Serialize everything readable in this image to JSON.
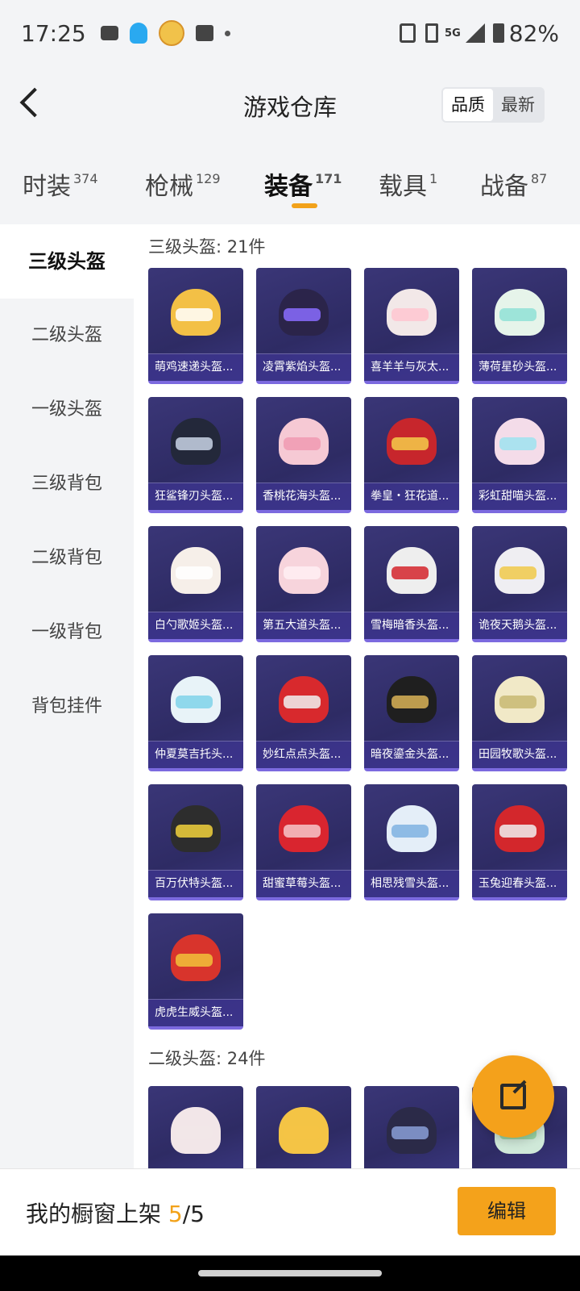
{
  "status_bar": {
    "time": "17:25",
    "network": "5G",
    "battery": "82%"
  },
  "header": {
    "title": "游戏仓库",
    "sort_options": [
      "品质",
      "最新"
    ],
    "sort_selected": "品质"
  },
  "tabs": [
    {
      "label": "时装",
      "count": "374"
    },
    {
      "label": "枪械",
      "count": "129"
    },
    {
      "label": "装备",
      "count": "171"
    },
    {
      "label": "载具",
      "count": "1"
    },
    {
      "label": "战备",
      "count": "87"
    }
  ],
  "active_tab": "装备",
  "sidebar": {
    "items": [
      "三级头盔",
      "二级头盔",
      "一级头盔",
      "三级背包",
      "二级背包",
      "一级背包",
      "背包挂件"
    ],
    "active": "三级头盔"
  },
  "sections": [
    {
      "title": "三级头盔: 21件",
      "items": [
        {
          "name": "萌鸡速递头盔...",
          "color": "#f3c046",
          "visor": "#ffffff"
        },
        {
          "name": "凌霄紫焰头盔...",
          "color": "#2b244a",
          "visor": "#8a6cff"
        },
        {
          "name": "喜羊羊与灰太...",
          "color": "#f2e8e8",
          "visor": "#ffc6d0"
        },
        {
          "name": "薄荷星砂头盔...",
          "color": "#e6f4ea",
          "visor": "#8fe0d6"
        },
        {
          "name": "狂鲨锋刃头盔...",
          "color": "#23283a",
          "visor": "#c9d4e6"
        },
        {
          "name": "香桃花海头盔...",
          "color": "#f6c9d4",
          "visor": "#f09ab2"
        },
        {
          "name": "拳皇・狂花道...",
          "color": "#c7262c",
          "visor": "#f4cc4a"
        },
        {
          "name": "彩虹甜喵头盔...",
          "color": "#f4dce9",
          "visor": "#9ee3f0"
        },
        {
          "name": "白勺歌姬头盔...",
          "color": "#f6efe9",
          "visor": "#ffffff"
        },
        {
          "name": "第五大道头盔...",
          "color": "#f7d4dc",
          "visor": "#ffeef3"
        },
        {
          "name": "雪梅暗香头盔...",
          "color": "#eeeeee",
          "visor": "#d4242c"
        },
        {
          "name": "诡夜天鹅头盔...",
          "color": "#efeef2",
          "visor": "#f0c94a"
        },
        {
          "name": "仲夏莫吉托头...",
          "color": "#e8f3f8",
          "visor": "#7fd2ea"
        },
        {
          "name": "妙红点点头盔...",
          "color": "#d8292d",
          "visor": "#f1f1f1"
        },
        {
          "name": "暗夜鎏金头盔...",
          "color": "#1f1f1f",
          "visor": "#d9b357"
        },
        {
          "name": "田园牧歌头盔...",
          "color": "#f1e9c7",
          "visor": "#c8b872"
        },
        {
          "name": "百万伏特头盔...",
          "color": "#2d2d2d",
          "visor": "#f2d23c"
        },
        {
          "name": "甜蜜草莓头盔...",
          "color": "#d9252f",
          "visor": "#f6c6c9"
        },
        {
          "name": "相思残雪头盔...",
          "color": "#e4eef8",
          "visor": "#7fb1e2"
        },
        {
          "name": "玉兔迎春头盔...",
          "color": "#d3272c",
          "visor": "#f0f0f0"
        },
        {
          "name": "虎虎生威头盔...",
          "color": "#d8342c",
          "visor": "#f2c23a"
        }
      ]
    },
    {
      "title": "二级头盔: 24件",
      "items": [
        {
          "name": "",
          "color": "#f2e6e8",
          "visor": "#f2e6e8"
        },
        {
          "name": "",
          "color": "#f4c445",
          "visor": "#f4c445"
        },
        {
          "name": "",
          "color": "#2b2a48",
          "visor": "#8a9fd8"
        },
        {
          "name": "",
          "color": "#cfe8d8",
          "visor": "#8fd09a"
        }
      ]
    }
  ],
  "bottom": {
    "label": "我的橱窗上架",
    "count": "5",
    "total": "/5",
    "edit": "编辑"
  }
}
